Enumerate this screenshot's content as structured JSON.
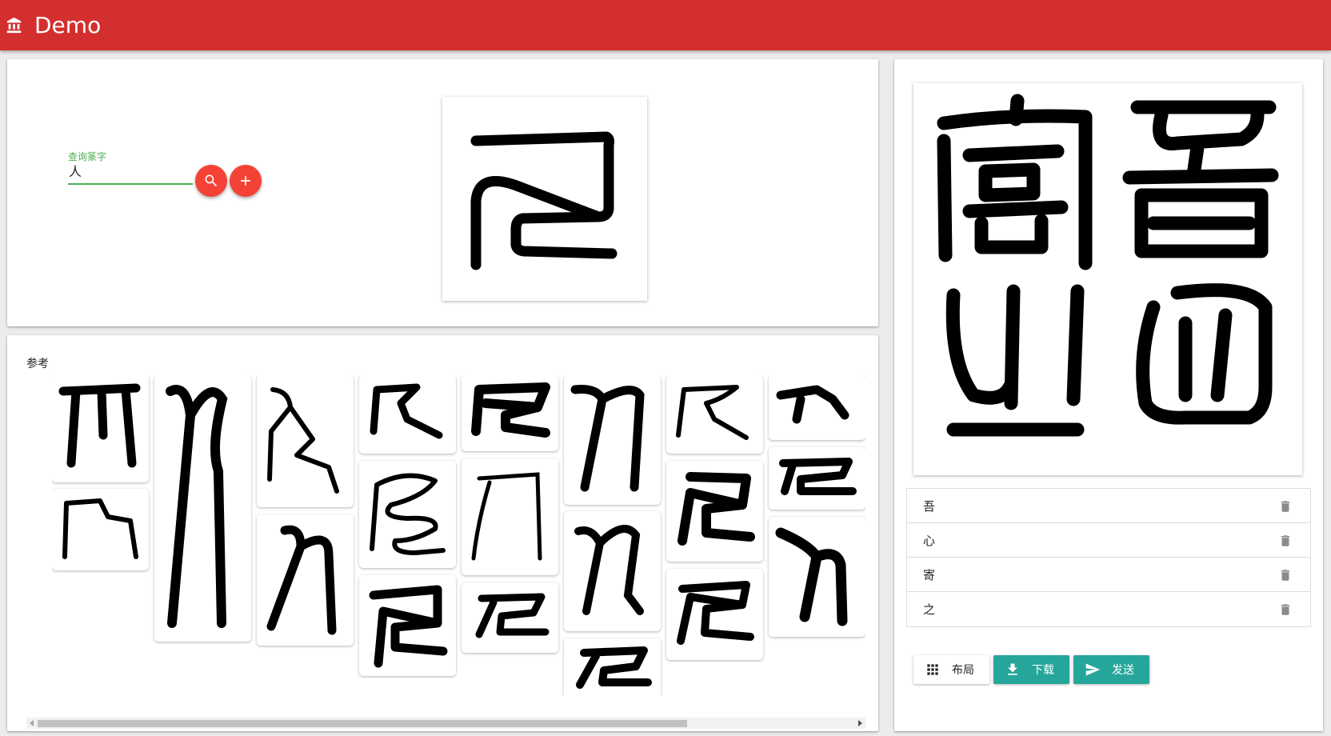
{
  "app": {
    "title": "Demo",
    "icon": "bank-icon",
    "color": "#d32f2f"
  },
  "search": {
    "label": "查询篆字",
    "value": "人",
    "search_icon": "search-icon",
    "add_icon": "add-icon",
    "accent": "#4caf50",
    "fab_color": "#f44336"
  },
  "reference": {
    "title": "参考",
    "column_count": 8
  },
  "composition": {
    "characters": [
      "吾",
      "心",
      "寄",
      "之"
    ],
    "delete_icon": "trash-icon"
  },
  "actions": {
    "layout_label": "布局",
    "download_label": "下载",
    "send_label": "发送",
    "accent": "#26a69a"
  }
}
